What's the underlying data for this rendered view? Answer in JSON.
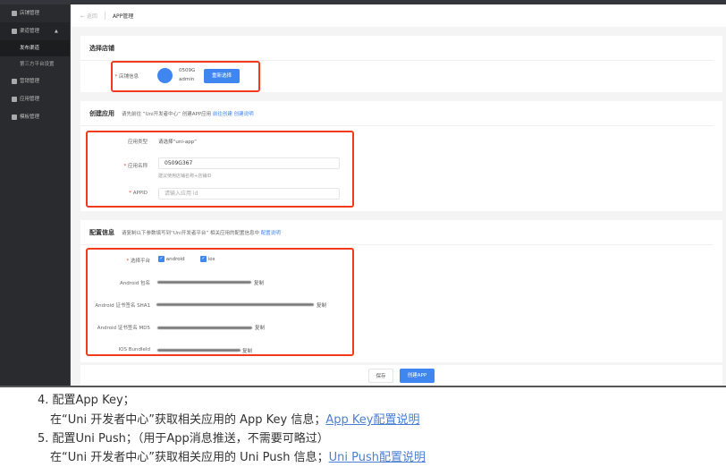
{
  "sidebar": {
    "items": [
      {
        "label": "店铺管理"
      },
      {
        "label": "渠道管理",
        "sub": [
          "发布渠道",
          "第三方平台设置"
        ]
      },
      {
        "label": "营销管理"
      },
      {
        "label": "应用管理"
      },
      {
        "label": "模板管理"
      }
    ]
  },
  "header": {
    "back": "← 返回",
    "title": "APP管理"
  },
  "store": {
    "title": "选择店铺",
    "label": "店铺信息",
    "name": "0509G",
    "account": "admin",
    "reselect": "重新选择"
  },
  "create": {
    "title": "创建应用",
    "hint": "请先前往 “Uni开发者中心” 创建APP应用",
    "link1": "前往创建",
    "link2": "创建说明",
    "type_label": "应用类型",
    "type_value": "请选择“uni-app”",
    "name_label": "应用名称",
    "name_value": "0509G367",
    "name_hint": "建议使用店铺名称+店铺ID",
    "appid_label": "APPID",
    "appid_placeholder": "请输入应用 id"
  },
  "config": {
    "title": "配置信息",
    "hint": "请复制以下参数填写到“Uni开发者平台” 相关应用的配置信息中",
    "link": "配置说明",
    "platform_label": "选择平台",
    "platforms": [
      "android",
      "ios"
    ],
    "rows": [
      {
        "label": "Android 包名",
        "copy": "复制"
      },
      {
        "label": "Android 证书签名 SHA1",
        "copy": "复制"
      },
      {
        "label": "Android 证书签名 MD5",
        "copy": "复制"
      },
      {
        "label": "IOS BundleId",
        "copy": "复制"
      }
    ]
  },
  "footer": {
    "save": "保存",
    "create": "创建APP"
  },
  "doc": {
    "step4": "4. 配置App Key；",
    "step4_text": "在“Uni 开发者中心”获取相关应用的 App Key 信息；",
    "step4_link": "App Key配置说明",
    "step5": "5. 配置Uni Push；（用于App消息推送，不需要可略过）",
    "step5_text": "在“Uni 开发者中心”获取相关应用的 Uni Push 信息；",
    "step5_link": "Uni Push配置说明"
  },
  "colors": {
    "accent": "#3f86f0",
    "highlight": "#f23a1d",
    "sidebar": "#2a2b2e"
  }
}
